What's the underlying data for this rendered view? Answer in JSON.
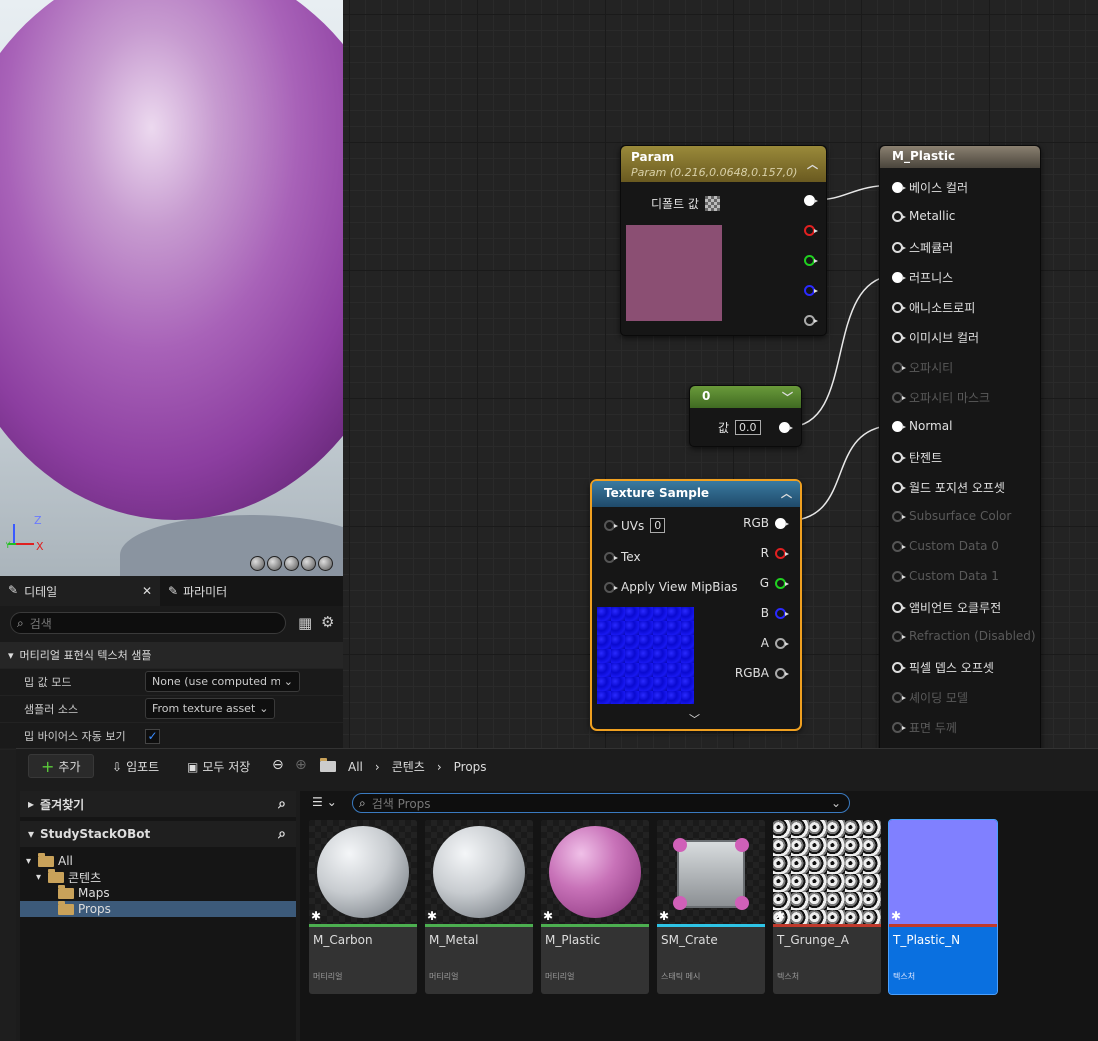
{
  "viewport": {
    "axis": {
      "z": "Z",
      "y": "Y",
      "x": "X"
    }
  },
  "graph": {
    "param_node": {
      "title": "Param",
      "subtitle": "Param (0.216,0.0648,0.157,0)",
      "default_label": "디폴트 값",
      "color": "#8b4f73"
    },
    "const_node": {
      "title": "0",
      "value_label": "값",
      "value": "0.0"
    },
    "texture_node": {
      "title": "Texture Sample",
      "uvs_label": "UVs",
      "uvs_value": "0",
      "tex_label": "Tex",
      "mip_label": "Apply View MipBias",
      "outputs": [
        "RGB",
        "R",
        "G",
        "B",
        "A",
        "RGBA"
      ]
    },
    "material_node": {
      "title": "M_Plastic",
      "pins": [
        {
          "label": "베이스 컬러",
          "connected": true,
          "enabled": true
        },
        {
          "label": "Metallic",
          "connected": false,
          "enabled": true
        },
        {
          "label": "스페큘러",
          "connected": false,
          "enabled": true
        },
        {
          "label": "러프니스",
          "connected": true,
          "enabled": true
        },
        {
          "label": "애니소트로피",
          "connected": false,
          "enabled": true
        },
        {
          "label": "이미시브 컬러",
          "connected": false,
          "enabled": true
        },
        {
          "label": "오파시티",
          "connected": false,
          "enabled": false
        },
        {
          "label": "오파시티 마스크",
          "connected": false,
          "enabled": false
        },
        {
          "label": "Normal",
          "connected": true,
          "enabled": true
        },
        {
          "label": "탄젠트",
          "connected": false,
          "enabled": true
        },
        {
          "label": "월드 포지션 오프셋",
          "connected": false,
          "enabled": true
        },
        {
          "label": "Subsurface Color",
          "connected": false,
          "enabled": false
        },
        {
          "label": "Custom Data 0",
          "connected": false,
          "enabled": false
        },
        {
          "label": "Custom Data 1",
          "connected": false,
          "enabled": false
        },
        {
          "label": "앰비언트 오클루전",
          "connected": false,
          "enabled": true
        },
        {
          "label": "Refraction (Disabled)",
          "connected": false,
          "enabled": false
        },
        {
          "label": "픽셀 뎁스 오프셋",
          "connected": false,
          "enabled": true
        },
        {
          "label": "셰이딩 모델",
          "connected": false,
          "enabled": false
        },
        {
          "label": "표면 두께",
          "connected": false,
          "enabled": false
        }
      ]
    }
  },
  "details": {
    "tab_details": "디테일",
    "tab_params": "파라미터",
    "search_placeholder": "검색",
    "section": "머티리얼 표현식 텍스처 샘플",
    "rows": [
      {
        "label": "밉 값 모드",
        "value": "None (use computed mi"
      },
      {
        "label": "샘플러 소스",
        "value": "From texture asset"
      },
      {
        "label": "밉 바이어스 자동 보기",
        "checked": true
      }
    ]
  },
  "browser": {
    "add": "추가",
    "import": "임포트",
    "save_all": "모두 저장",
    "path": [
      "All",
      "콘텐츠",
      "Props"
    ],
    "favorites": "즐겨찾기",
    "project": "StudyStackOBot",
    "tree": [
      {
        "label": "All",
        "level": 0
      },
      {
        "label": "콘텐츠",
        "level": 1
      },
      {
        "label": "Maps",
        "level": 2
      },
      {
        "label": "Props",
        "level": 2,
        "selected": true
      }
    ],
    "search_placeholder": "검색 Props",
    "assets": [
      {
        "name": "M_Carbon",
        "type": "머티리얼",
        "strip": "#4caf50"
      },
      {
        "name": "M_Metal",
        "type": "머티리얼",
        "strip": "#4caf50"
      },
      {
        "name": "M_Plastic",
        "type": "머티리얼",
        "strip": "#4caf50"
      },
      {
        "name": "SM_Crate",
        "type": "스태틱 메시",
        "strip": "#2ec4e6"
      },
      {
        "name": "T_Grunge_A",
        "type": "텍스처",
        "strip": "#c0392b"
      },
      {
        "name": "T_Plastic_N",
        "type": "텍스처",
        "strip": "#c0392b",
        "selected": true
      }
    ]
  }
}
